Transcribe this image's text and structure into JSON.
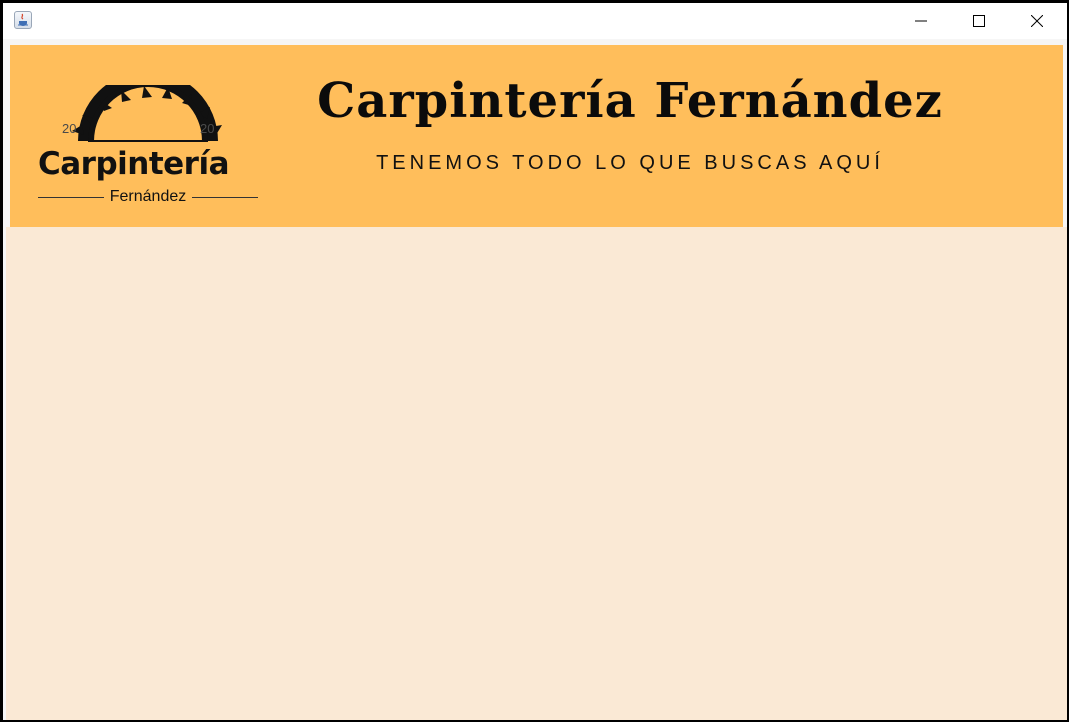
{
  "window": {
    "title": ""
  },
  "banner": {
    "logo": {
      "year_left": "20",
      "year_right": "20",
      "word": "Carpintería",
      "sub": "Fernández"
    },
    "title": "Carpintería Fernández",
    "tagline": "TENEMOS TODO LO QUE BUSCAS AQUÍ"
  },
  "colors": {
    "banner_background": "#ffbe5b",
    "main_background": "#fae9d5"
  }
}
